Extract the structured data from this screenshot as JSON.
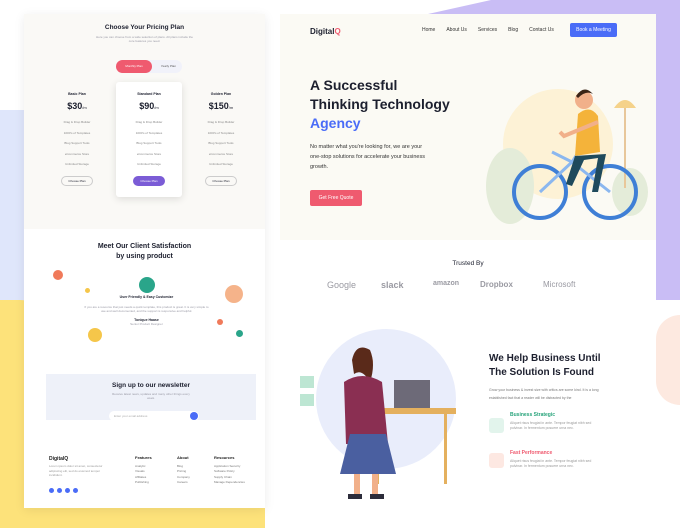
{
  "pricing": {
    "title": "Choose Your Pricing Plan",
    "subtitle": "Here you can choose from a wide selection of plans. All plans include the core features you need.",
    "toggle_monthly": "Monthly Plan",
    "toggle_yearly": "Yearly Plan",
    "plans": [
      {
        "name": "Basic Plan",
        "price": "$30",
        "period": "/m",
        "features": [
          "Drag & Drop Builder",
          "1000's of Templates",
          "Blog Support Tools",
          "eCommerce Store",
          "Unlimited Storage"
        ],
        "cta": "Choose Plan"
      },
      {
        "name": "Standard Plan",
        "price": "$90",
        "period": "/m",
        "features": [
          "Drag & Drop Builder",
          "1000's of Templates",
          "Blog Support Tools",
          "eCommerce Store",
          "Unlimited Storage"
        ],
        "cta": "Choose Plan"
      },
      {
        "name": "Golden Plan",
        "price": "$150",
        "period": "/m",
        "features": [
          "Drag & Drop Builder",
          "1000's of Templates",
          "Blog Support Tools",
          "eCommerce Store",
          "Unlimited Storage"
        ],
        "cta": "Choose Plan"
      }
    ]
  },
  "testimonial": {
    "title_line1": "Meet Our Client Satisfaction",
    "title_line2": "by using product",
    "reviewer_heading": "User Friendly & Easy Customize",
    "quote": "If you are a resource that just needs a quick template, this product is great. It is very simple to use and well documented, and the support is responsive and helpful.",
    "author": "Tonique Haase",
    "role": "Senior Product Designer"
  },
  "newsletter": {
    "title": "Sign up to our newsletter",
    "desc": "Receive latest news, updates and many other things every week.",
    "placeholder": "Enter your email address"
  },
  "footer": {
    "logo": "DigitalQ",
    "desc": "Lorem ipsum dolor sit amet, consectetur adipiscing elit, sed do eiusmod tempor incididunt.",
    "cols": [
      {
        "title": "Features",
        "items": [
          "Analytic",
          "Visuals",
          "Affiliates",
          "Publishing"
        ]
      },
      {
        "title": "About",
        "items": [
          "Blog",
          "Pricing",
          "Company",
          "Careers"
        ]
      },
      {
        "title": "Resources",
        "items": [
          "Application Security",
          "Software Policy",
          "Supply Chain",
          "Manage Dependencies"
        ]
      }
    ]
  },
  "header": {
    "logo": "Digital",
    "logo_accent": "Q",
    "nav": [
      "Home",
      "About Us",
      "Services",
      "Blog",
      "Contact Us"
    ],
    "cta": "Book a Meeting"
  },
  "hero": {
    "line1": "A Successful",
    "line2": "Thinking Technology",
    "line3": "Agency",
    "desc": "No matter what you're looking for, we are your one-stop solutions for accelerate your business growth.",
    "cta": "Get Free Quote"
  },
  "trusted": {
    "title": "Trusted By",
    "brands": [
      "Google",
      "slack",
      "amazon",
      "Dropbox",
      "Microsoft"
    ]
  },
  "solution": {
    "title_line1": "We Help Business Until",
    "title_line2": "The Solution Is Found",
    "desc": "Grow your business & invest size with critics are some kind. It is a long established fact that a reader will be distracted by the",
    "features": [
      {
        "title": "Business Strategic",
        "desc": "Aliquet risus feugiat in ante. Tempor feugiat nibh sed pulvinar. In fermentum posuere urna nec."
      },
      {
        "title": "Fast Performance",
        "desc": "Aliquet risus feugiat in ante. Tempor feugiat nibh sed pulvinar. In fermentum posuere urna nec."
      }
    ]
  },
  "colors": {
    "accent_red": "#ef5a6f",
    "accent_blue": "#4a6cf7",
    "purple": "#7b5cd6"
  }
}
